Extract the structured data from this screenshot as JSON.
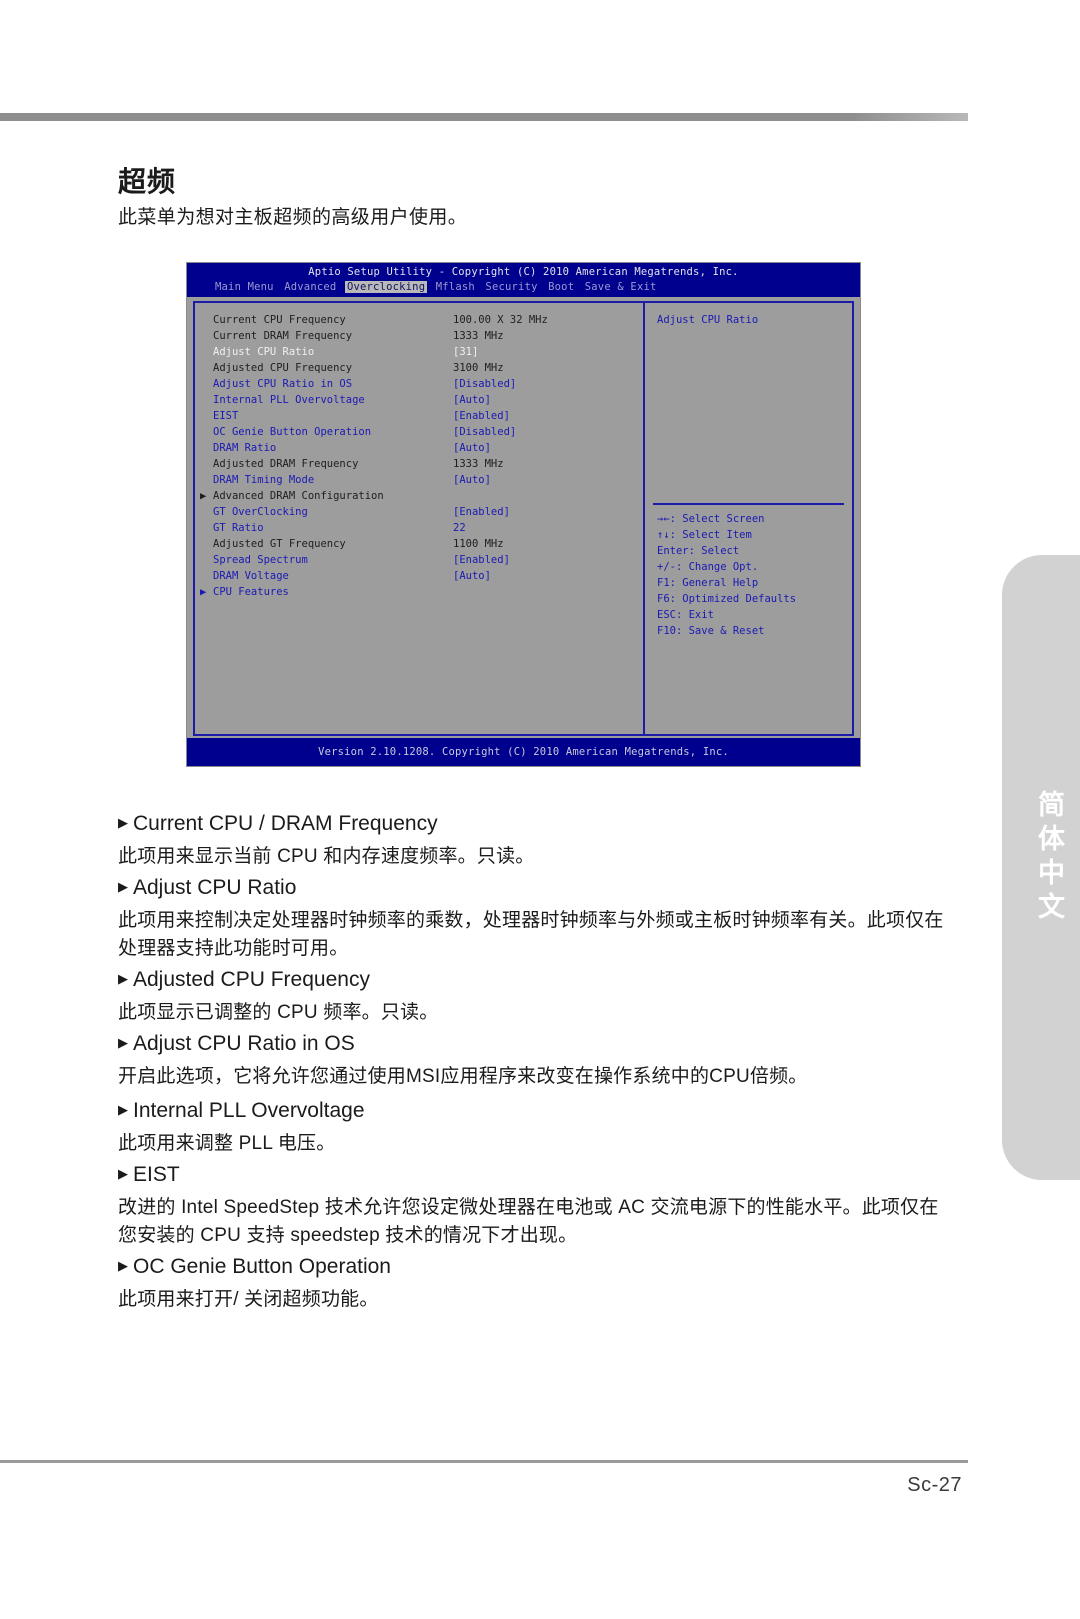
{
  "page": {
    "section_title": "超频",
    "section_intro": "此菜单为想对主板超频的高级用户使用。",
    "page_number": "Sc-27",
    "language_tab": "简体中文"
  },
  "bios": {
    "title": "Aptio Setup Utility - Copyright (C) 2010 American Megatrends, Inc.",
    "menu": [
      "Main Menu",
      "Advanced",
      "Overclocking",
      "Mflash",
      "Security",
      "Boot",
      "Save & Exit"
    ],
    "active_menu": "Overclocking",
    "footer": "Version 2.10.1208. Copyright (C) 2010 American Megatrends, Inc.",
    "rows": [
      {
        "label": "Current CPU Frequency",
        "value": "100.00 X 32 MHz",
        "style": "grey",
        "arrow": ""
      },
      {
        "label": "Current DRAM Frequency",
        "value": "1333 MHz",
        "style": "grey",
        "arrow": ""
      },
      {
        "label": "Adjust CPU Ratio",
        "value": "[31]",
        "style": "white",
        "arrow": ""
      },
      {
        "label": "Adjusted CPU Frequency",
        "value": "3100 MHz",
        "style": "grey",
        "arrow": ""
      },
      {
        "label": "Adjust CPU Ratio in OS",
        "value": "[Disabled]",
        "style": "blue",
        "arrow": ""
      },
      {
        "label": "Internal PLL Overvoltage",
        "value": "[Auto]",
        "style": "blue",
        "arrow": ""
      },
      {
        "label": "EIST",
        "value": "[Enabled]",
        "style": "blue",
        "arrow": ""
      },
      {
        "label": "OC Genie Button Operation",
        "value": "[Disabled]",
        "style": "blue",
        "arrow": ""
      },
      {
        "label": "DRAM Ratio",
        "value": "[Auto]",
        "style": "blue",
        "arrow": ""
      },
      {
        "label": "Adjusted DRAM Frequency",
        "value": "1333 MHz",
        "style": "grey",
        "arrow": ""
      },
      {
        "label": "DRAM Timing Mode",
        "value": "[Auto]",
        "style": "blue",
        "arrow": ""
      },
      {
        "label": "Advanced DRAM Configuration",
        "value": "",
        "style": "grey",
        "arrow": "▶"
      },
      {
        "label": "GT OverClocking",
        "value": "[Enabled]",
        "style": "blue",
        "arrow": ""
      },
      {
        "label": "GT Ratio",
        "value": "22",
        "style": "blue",
        "arrow": ""
      },
      {
        "label": "Adjusted GT Frequency",
        "value": "1100 MHz",
        "style": "grey",
        "arrow": ""
      },
      {
        "label": "Spread Spectrum",
        "value": "[Enabled]",
        "style": "blue",
        "arrow": ""
      },
      {
        "label": "DRAM Voltage",
        "value": "[Auto]",
        "style": "blue",
        "arrow": ""
      },
      {
        "label": "CPU Features",
        "value": "",
        "style": "blue",
        "arrow": "▶"
      }
    ],
    "help_title": "Adjust CPU Ratio",
    "help_keys": [
      "→←: Select Screen",
      "↑↓: Select Item",
      "Enter: Select",
      "+/-: Change Opt.",
      "F1: General Help",
      "F6: Optimized Defaults",
      "ESC: Exit",
      "F10: Save & Reset"
    ]
  },
  "items": [
    {
      "heading": "Current CPU / DRAM Frequency",
      "body": "此项用来显示当前 CPU 和内存速度频率。只读。"
    },
    {
      "heading": "Adjust CPU Ratio",
      "body": "此项用来控制决定处理器时钟频率的乘数，处理器时钟频率与外频或主板时钟频率有关。此项仅在处理器支持此功能时可用。"
    },
    {
      "heading": "Adjusted CPU Frequency",
      "body": "此项显示已调整的 CPU 频率。只读。"
    },
    {
      "heading": "Adjust CPU Ratio in OS",
      "body": "开启此选项，它将允许您通过使用MSI应用程序来改变在操作系统中的CPU倍频。"
    },
    {
      "heading": "Internal PLL Overvoltage",
      "body": "此项用来调整 PLL 电压。"
    },
    {
      "heading": "EIST",
      "body": "改进的 Intel SpeedStep 技术允许您设定微处理器在电池或 AC 交流电源下的性能水平。此项仅在您安装的 CPU 支持 speedstep 技术的情况下才出现。"
    },
    {
      "heading": "OC Genie Button Operation",
      "body": "此项用来打开/ 关闭超频功能。"
    }
  ]
}
